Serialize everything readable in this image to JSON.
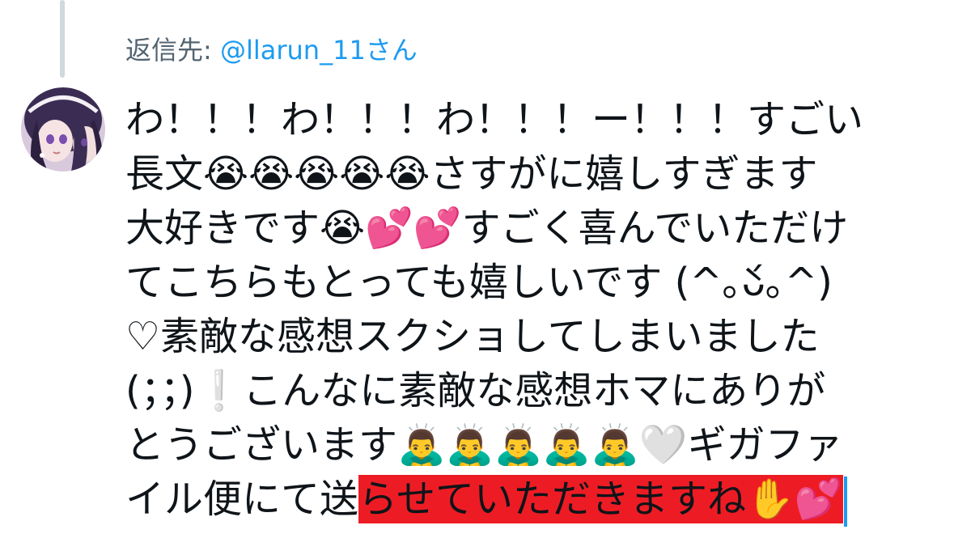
{
  "reply": {
    "prefix": "返信先: ",
    "handle": "@llarun_11さん"
  },
  "tweet": {
    "lines": [
      "わ！！！わ！！！わ！！！ー！！！すごい",
      "長文😭😭😭😭😭さすがに嬉しすぎます",
      "大好きです😭💕💕すごく喜んでいただけ",
      "てこちらもとっても嬉しいです (^｡̀ᴗ́｡^)",
      "♡素敵な感想スクショしてしまいました",
      "(；；)❕こんなに素敵な感想ホマにありが",
      "とうございます🙇‍♂️🙇‍♂️🙇‍♂️🙇‍♂️🙇‍♂️🤍ギガファ"
    ],
    "last_line_plain": "イル便にて送",
    "last_line_selected": "らせていただきますね✋💕"
  },
  "colors": {
    "selection": "#ed1c24",
    "link": "#1d9bf0",
    "caret": "#1d9bf0"
  }
}
